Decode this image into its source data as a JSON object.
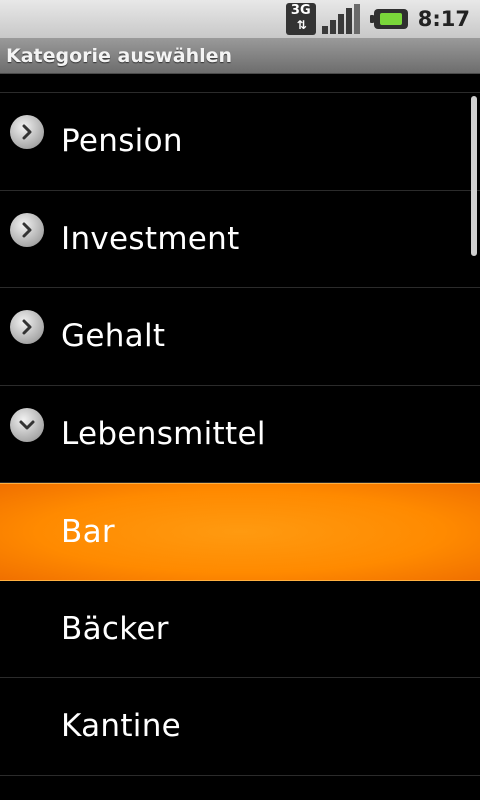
{
  "status_bar": {
    "network_label": "3G",
    "time": "8:17"
  },
  "title_bar": {
    "title": "Kategorie auswählen"
  },
  "list": {
    "items": [
      {
        "label": "Pension",
        "type": "group",
        "expanded": false,
        "icon": "chevron-right-icon"
      },
      {
        "label": "Investment",
        "type": "group",
        "expanded": false,
        "icon": "chevron-right-icon"
      },
      {
        "label": "Gehalt",
        "type": "group",
        "expanded": false,
        "icon": "chevron-right-icon"
      },
      {
        "label": "Lebensmittel",
        "type": "group",
        "expanded": true,
        "icon": "chevron-down-icon"
      },
      {
        "label": "Bar",
        "type": "child",
        "selected": true
      },
      {
        "label": "Bäcker",
        "type": "child",
        "selected": false
      },
      {
        "label": "Kantine",
        "type": "child",
        "selected": false
      }
    ]
  },
  "colors": {
    "selection": "#ff8a00",
    "background": "#000000",
    "title_bar": "#7f7f7f"
  }
}
